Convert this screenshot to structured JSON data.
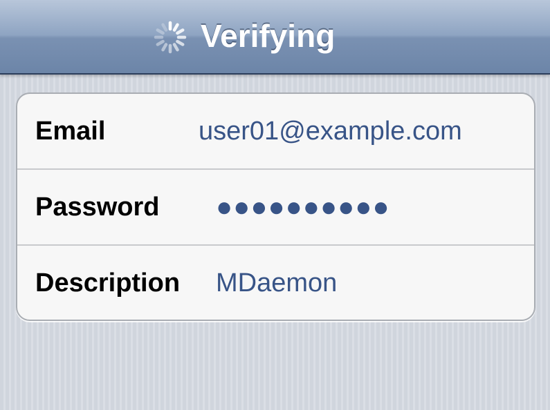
{
  "nav": {
    "title": "Verifying",
    "spinner_icon": "activity-spinner-icon"
  },
  "form": {
    "rows": [
      {
        "label": "Email",
        "value": "user01@example.com"
      },
      {
        "label": "Password",
        "value": "●●●●●●●●●●"
      },
      {
        "label": "Description",
        "value": "MDaemon"
      }
    ]
  },
  "colors": {
    "value_text": "#385487",
    "nav_bar": "#7a91b2"
  }
}
